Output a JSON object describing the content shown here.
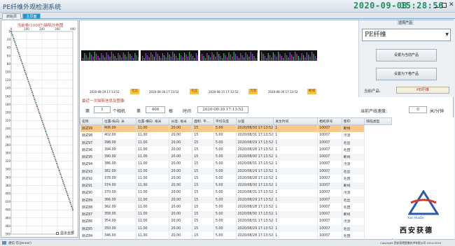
{
  "app": {
    "title": "PE纤维外观检测系统"
  },
  "clock": {
    "date": "2020-09-08",
    "time": "15:28:56"
  },
  "tabs": {
    "start": "启始页",
    "main": "主页面"
  },
  "defect_map": {
    "title": "当前卷(10007)缺陷分布图",
    "x_ticks": [
      "0",
      "100",
      "200",
      "300",
      "400"
    ],
    "y_ticks": [
      "0",
      "20",
      "40",
      "60",
      "80",
      "100",
      "120",
      "140",
      "160",
      "180",
      "200",
      "220",
      "240",
      "260",
      "280",
      "300",
      "320",
      "340",
      "360",
      "380",
      "400",
      "420",
      "440",
      "460",
      "480",
      "500"
    ],
    "xlim": [
      0,
      400
    ],
    "ylim": [
      0,
      500
    ],
    "line_from": [
      0,
      0
    ],
    "line_to": [
      400,
      440
    ],
    "colors": [
      "#9b2d7e",
      "#2fae4a"
    ],
    "show_all_label": "显示全部"
  },
  "thumbnails": [
    {
      "timestamp": "2020-08-29 17:13:52",
      "tag": "毛丝"
    },
    {
      "timestamp": "2020-08-30 17:13:52",
      "tag": "毛丝"
    },
    {
      "timestamp": "2020-08-31 17:13:52",
      "tag": "污渍"
    },
    {
      "timestamp": "2020-08-30 17:13:52",
      "tag": "断线"
    }
  ],
  "product": {
    "group_label": "选择产品",
    "selected": "PE纤维",
    "set_current_label": "设置为当前产品",
    "set_next_label": "设置为下卷产品",
    "current_label": "当前产品:",
    "current_value": "PE纤维"
  },
  "recent": {
    "title": "最近一次缺陷信息及图像:",
    "no_label": "第",
    "camera_value": "1",
    "camera_label": "个相机",
    "no_label2": "第",
    "root_value": "406",
    "root_label": "根",
    "time_label": "时间",
    "time_value": "2020-08-30 17:13:52",
    "speed_label": "当前产线速度:",
    "speed_value": "0",
    "speed_unit": "米/分钟"
  },
  "table": {
    "columns": [
      "名称",
      "位置-纵向: 米",
      "位置-横向: 毫米",
      "长度: 毫米",
      "面积: 平...",
      "平均灰度",
      "分值",
      "发生时间",
      "相机序号",
      "卷ID",
      "缺陷类型"
    ],
    "rows": [
      [
        "测试99",
        "406.00",
        "11.00",
        "20.00",
        "15",
        "5.00",
        "2020/08/30 17:13:52",
        "1",
        "10007",
        "断线"
      ],
      [
        "测试98",
        "402.00",
        "11.00",
        "20.00",
        "15",
        "5.00",
        "2020/08/31 17:13:52",
        "1",
        "10007",
        "污渍"
      ],
      [
        "测试97",
        "398.00",
        "11.00",
        "20.00",
        "15",
        "5.00",
        "2020/08/29 17:13:52",
        "1",
        "10007",
        "毛丝"
      ],
      [
        "测试96",
        "394.00",
        "11.00",
        "20.00",
        "15",
        "5.00",
        "2020/08/28 17:13:52",
        "1",
        "10007",
        "毛团"
      ],
      [
        "测试95",
        "390.00",
        "11.00",
        "20.00",
        "15",
        "5.00",
        "2020/08/30 17:13:52",
        "1",
        "10007",
        "断线"
      ],
      [
        "测试94",
        "386.00",
        "11.00",
        "20.00",
        "15",
        "5.00",
        "2020/08/31 17:13:52",
        "1",
        "10007",
        "污渍"
      ],
      [
        "测试93",
        "382.00",
        "11.00",
        "20.00",
        "15",
        "5.00",
        "2020/08/29 17:13:52",
        "1",
        "10007",
        "毛丝"
      ],
      [
        "测试92",
        "378.00",
        "11.00",
        "20.00",
        "15",
        "5.00",
        "2020/08/28 17:13:52",
        "1",
        "10007",
        "毛团"
      ],
      [
        "测试91",
        "374.00",
        "11.00",
        "20.00",
        "15",
        "5.00",
        "2020/08/30 17:13:52",
        "1",
        "10007",
        "断线"
      ],
      [
        "测试90",
        "370.00",
        "11.00",
        "20.00",
        "15",
        "5.00",
        "2020/08/31 17:13:52",
        "1",
        "10007",
        "污渍"
      ],
      [
        "测试89",
        "366.00",
        "11.00",
        "20.00",
        "15",
        "5.00",
        "2020/08/29 17:13:52",
        "1",
        "10007",
        "毛丝"
      ],
      [
        "测试88",
        "362.00",
        "11.00",
        "20.00",
        "15",
        "5.00",
        "2020/08/28 17:13:52",
        "1",
        "10007",
        "毛团"
      ],
      [
        "测试87",
        "358.00",
        "11.00",
        "20.00",
        "15",
        "5.00",
        "2020/08/30 17:13:52",
        "1",
        "10007",
        "断线"
      ],
      [
        "测试86",
        "354.00",
        "11.00",
        "20.00",
        "15",
        "5.00",
        "2020/08/31 17:13:52",
        "1",
        "10007",
        "污渍"
      ],
      [
        "测试85",
        "350.00",
        "11.00",
        "20.00",
        "15",
        "5.00",
        "2020/08/29 17:13:52",
        "1",
        "10007",
        "毛丝"
      ],
      [
        "测试84",
        "346.00",
        "11.00",
        "20.00",
        "15",
        "5.00",
        "2020/08/28 17:13:52",
        "1",
        "10007",
        "毛团"
      ]
    ]
  },
  "logo": {
    "brand": "Xian HuoDe",
    "name": "西安获德"
  },
  "status": {
    "left": "通信:在(Janoer)",
    "right": "Copyright 西安获德图像技术有限公司   2014-2020"
  }
}
